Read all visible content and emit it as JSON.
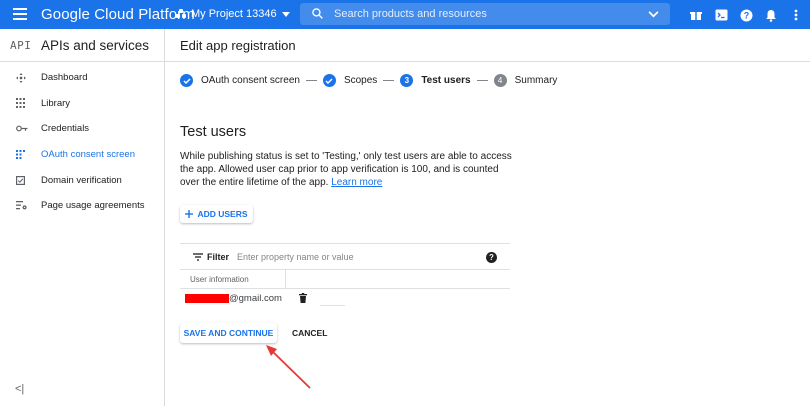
{
  "topbar": {
    "brand": "Google Cloud Platform",
    "project": "My Project 13346",
    "search_placeholder": "Search products and resources"
  },
  "sidebar": {
    "api_label": "API",
    "title": "APIs and services",
    "items": [
      {
        "label": "Dashboard",
        "icon": "dashboard-icon"
      },
      {
        "label": "Library",
        "icon": "library-icon"
      },
      {
        "label": "Credentials",
        "icon": "key-icon"
      },
      {
        "label": "OAuth consent screen",
        "icon": "oauth-icon",
        "active": true
      },
      {
        "label": "Domain verification",
        "icon": "checkbox-icon"
      },
      {
        "label": "Page usage agreements",
        "icon": "settings-list-icon"
      }
    ],
    "collapse_label": "<|"
  },
  "main": {
    "header": "Edit app registration",
    "steps": [
      {
        "label": "OAuth consent screen",
        "state": "done"
      },
      {
        "label": "Scopes",
        "state": "done"
      },
      {
        "number": "3",
        "label": "Test users",
        "state": "current"
      },
      {
        "number": "4",
        "label": "Summary",
        "state": "todo"
      }
    ],
    "section_title": "Test users",
    "description": "While publishing status is set to 'Testing,' only test users are able to access the app. Allowed user cap prior to app verification is 100, and is counted over the entire lifetime of the app.",
    "learn_more": "Learn more",
    "add_users_label": "ADD USERS",
    "filter": {
      "label": "Filter",
      "placeholder": "Enter property name or value"
    },
    "table": {
      "header": "User information",
      "rows": [
        {
          "email_suffix": "@gmail.com"
        }
      ]
    },
    "save_label": "SAVE AND CONTINUE",
    "cancel_label": "CANCEL"
  },
  "colors": {
    "brand_blue": "#1a73e8",
    "annotation_red": "#e53935",
    "redaction": "#ff0000"
  }
}
